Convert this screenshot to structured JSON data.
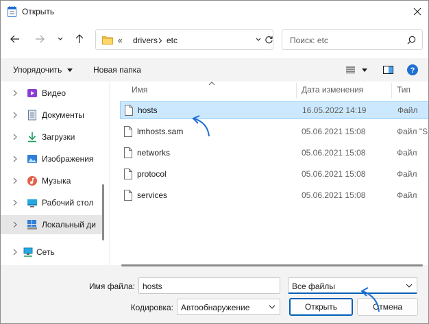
{
  "window": {
    "title": "Открыть"
  },
  "address": {
    "overflow": "«",
    "segments": [
      "drivers",
      "etc"
    ],
    "search_placeholder": "Поиск: etc"
  },
  "toolbar": {
    "organize": "Упорядочить",
    "new_folder": "Новая папка"
  },
  "sidebar": {
    "items": [
      {
        "label": "Видео",
        "icon": "video-icon"
      },
      {
        "label": "Документы",
        "icon": "documents-icon"
      },
      {
        "label": "Загрузки",
        "icon": "downloads-icon"
      },
      {
        "label": "Изображения",
        "icon": "pictures-icon"
      },
      {
        "label": "Музыка",
        "icon": "music-icon"
      },
      {
        "label": "Рабочий стол",
        "icon": "desktop-icon"
      },
      {
        "label": "Локальный ди",
        "icon": "local-disk-icon",
        "selected": true
      },
      {
        "label": "Сеть",
        "icon": "network-icon"
      }
    ]
  },
  "columns": {
    "name": "Имя",
    "modified": "Дата изменения",
    "type": "Тип"
  },
  "files": [
    {
      "name": "hosts",
      "modified": "16.05.2022 14:19",
      "type": "Файл",
      "selected": true
    },
    {
      "name": "lmhosts.sam",
      "modified": "05.06.2021 15:08",
      "type": "Файл \"S"
    },
    {
      "name": "networks",
      "modified": "05.06.2021 15:08",
      "type": "Файл"
    },
    {
      "name": "protocol",
      "modified": "05.06.2021 15:08",
      "type": "Файл"
    },
    {
      "name": "services",
      "modified": "05.06.2021 15:08",
      "type": "Файл"
    }
  ],
  "footer": {
    "filename_label": "Имя файла:",
    "filename_value": "hosts",
    "filter_value": "Все файлы",
    "encoding_label": "Кодировка:",
    "encoding_value": "Автообнаружение",
    "open_label": "Открыть",
    "cancel_label": "Отмена"
  },
  "colors": {
    "accent": "#005fb8",
    "selection": "#cce8ff",
    "annotation_arrow": "#1f6fd1"
  }
}
